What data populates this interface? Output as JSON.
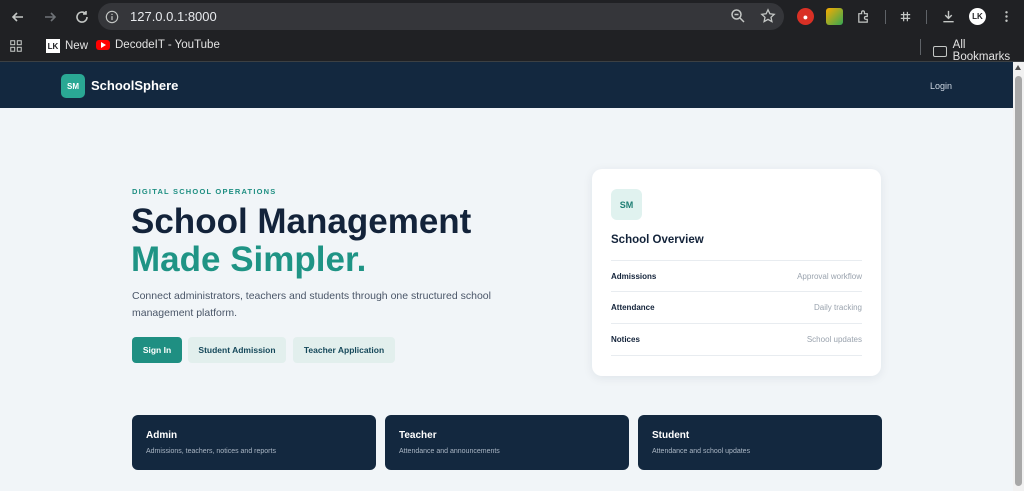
{
  "browser": {
    "url": "127.0.0.1:8000",
    "bookmarks": {
      "new_label": "New",
      "new_icon_text": "LK",
      "youtube_label": "DecodeIT - YouTube",
      "all_bookmarks_label": "All Bookmarks"
    },
    "profile_initials": "LK"
  },
  "header": {
    "logo_badge": "SM",
    "brand": "SchoolSphere",
    "login": "Login"
  },
  "hero": {
    "eyebrow": "DIGITAL SCHOOL OPERATIONS",
    "title_line1": "School Management",
    "title_line2": "Made Simpler.",
    "description": "Connect administrators, teachers and students through one structured school management platform.",
    "buttons": {
      "sign_in": "Sign In",
      "student_admission": "Student Admission",
      "teacher_application": "Teacher Application"
    }
  },
  "overview": {
    "badge": "SM",
    "title": "School Overview",
    "rows": [
      {
        "key": "Admissions",
        "value": "Approval workflow"
      },
      {
        "key": "Attendance",
        "value": "Daily tracking"
      },
      {
        "key": "Notices",
        "value": "School updates"
      }
    ]
  },
  "roles": [
    {
      "title": "Admin",
      "desc": "Admissions, teachers, notices and reports"
    },
    {
      "title": "Teacher",
      "desc": "Attendance and announcements"
    },
    {
      "title": "Student",
      "desc": "Attendance and school updates"
    }
  ],
  "colors": {
    "navy": "#13283f",
    "teal": "#1f8f82",
    "page_bg": "#f1f5f8"
  }
}
